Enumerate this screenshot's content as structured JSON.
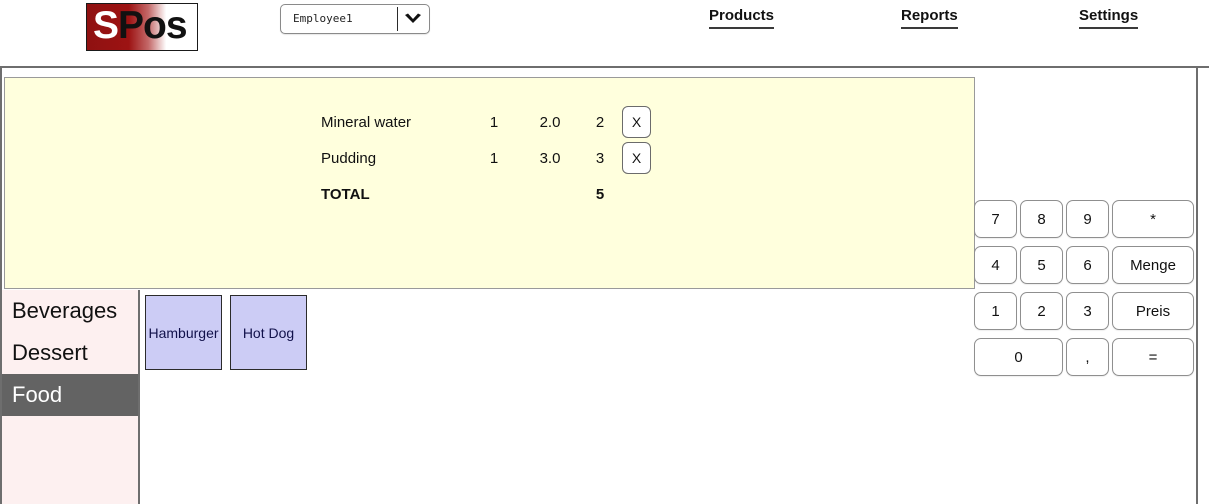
{
  "header": {
    "logo": {
      "first_letter": "S",
      "rest": "Pos",
      "name": "spos-logo"
    },
    "employee_select": {
      "value": "Employee1",
      "caret_icon": "chevron-down-icon"
    },
    "nav": [
      {
        "label": "Products",
        "name": "nav-products"
      },
      {
        "label": "Reports",
        "name": "nav-reports"
      },
      {
        "label": "Settings",
        "name": "nav-settings"
      }
    ]
  },
  "receipt": {
    "items": [
      {
        "name": "Mineral water",
        "qty": "1",
        "price": "2.0",
        "sum": "2",
        "delete_label": "X"
      },
      {
        "name": "Pudding",
        "qty": "1",
        "price": "3.0",
        "sum": "3",
        "delete_label": "X"
      }
    ],
    "total_label": "TOTAL",
    "total_value": "5"
  },
  "categories": [
    {
      "label": "Beverages",
      "selected": false
    },
    {
      "label": "Dessert",
      "selected": false
    },
    {
      "label": "Food",
      "selected": true
    }
  ],
  "products": [
    {
      "label": "Hamburger"
    },
    {
      "label": "Hot Dog"
    }
  ],
  "keypad": [
    {
      "label": "7"
    },
    {
      "label": "8"
    },
    {
      "label": "9"
    },
    {
      "label": "*"
    },
    {
      "label": "4"
    },
    {
      "label": "5"
    },
    {
      "label": "6"
    },
    {
      "label": "Menge"
    },
    {
      "label": "1"
    },
    {
      "label": "2"
    },
    {
      "label": "3"
    },
    {
      "label": "Preis"
    },
    {
      "label": "0"
    },
    {
      "label": ","
    },
    {
      "label": "="
    }
  ],
  "colors": {
    "receipt_bg": "#ffffdd",
    "sidebar_bg": "#fdf0f0",
    "selected_category_bg": "#636363",
    "product_btn_bg": "#ccccf5",
    "logo_red": "#9d1313",
    "border": "#6e6e6e"
  }
}
